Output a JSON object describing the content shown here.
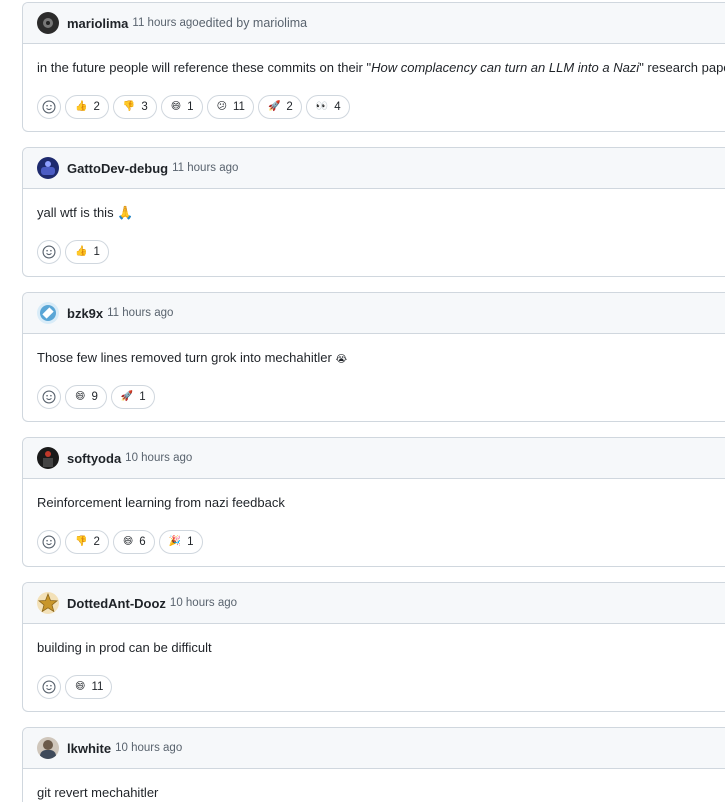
{
  "comments": [
    {
      "author": "mariolima",
      "timestamp": "11 hours ago",
      "edited": "edited by mariolima",
      "body_pre": "in the future people will reference these commits on their \"",
      "body_em": "How complacency can turn an LLM into a Nazi",
      "body_post": "\" research papers",
      "avatar_color": "#2b2b2b",
      "reactions": [
        {
          "emoji": "👍",
          "icon": "thumbs-up-icon",
          "count": "2"
        },
        {
          "emoji": "👎",
          "icon": "thumbs-down-icon",
          "count": "3"
        },
        {
          "emoji": "😄",
          "icon": "laugh-icon",
          "count": "1"
        },
        {
          "emoji": "😕",
          "icon": "confused-icon",
          "count": "11"
        },
        {
          "emoji": "🚀",
          "icon": "rocket-icon",
          "count": "2"
        },
        {
          "emoji": "👀",
          "icon": "eyes-icon",
          "count": "4"
        }
      ]
    },
    {
      "author": "GattoDev-debug",
      "timestamp": "11 hours ago",
      "body": "yall wtf is this",
      "body_emoji": "🙏",
      "avatar_color": "#1e2a6e",
      "reactions": [
        {
          "emoji": "👍",
          "icon": "thumbs-up-icon",
          "count": "1"
        }
      ]
    },
    {
      "author": "bzk9x",
      "timestamp": "11 hours ago",
      "body": "Those few lines removed turn grok into mechahitler",
      "body_emoji": "😭",
      "avatar_color": "#5aa6d6",
      "reactions": [
        {
          "emoji": "😄",
          "icon": "laugh-icon",
          "count": "9"
        },
        {
          "emoji": "🚀",
          "icon": "rocket-icon",
          "count": "1"
        }
      ]
    },
    {
      "author": "softyoda",
      "timestamp": "10 hours ago",
      "body": "Reinforcement learning from nazi feedback",
      "avatar_color": "#1a1a1a",
      "reactions": [
        {
          "emoji": "👎",
          "icon": "thumbs-down-icon",
          "count": "2"
        },
        {
          "emoji": "😄",
          "icon": "laugh-icon",
          "count": "6"
        },
        {
          "emoji": "🎉",
          "icon": "hooray-icon",
          "count": "1"
        }
      ]
    },
    {
      "author": "DottedAnt-Dooz",
      "timestamp": "10 hours ago",
      "body": "building in prod can be difficult",
      "avatar_color": "#c8962a",
      "reactions": [
        {
          "emoji": "😄",
          "icon": "laugh-icon",
          "count": "11"
        }
      ]
    },
    {
      "author": "lkwhite",
      "timestamp": "10 hours ago",
      "body": "git revert mechahitler",
      "avatar_color": "#6b5a4a",
      "reactions": []
    }
  ],
  "colors": {
    "border": "#d0d7de",
    "header_bg": "#f6f8fa",
    "muted_text": "#59636e",
    "text": "#1f2328"
  }
}
